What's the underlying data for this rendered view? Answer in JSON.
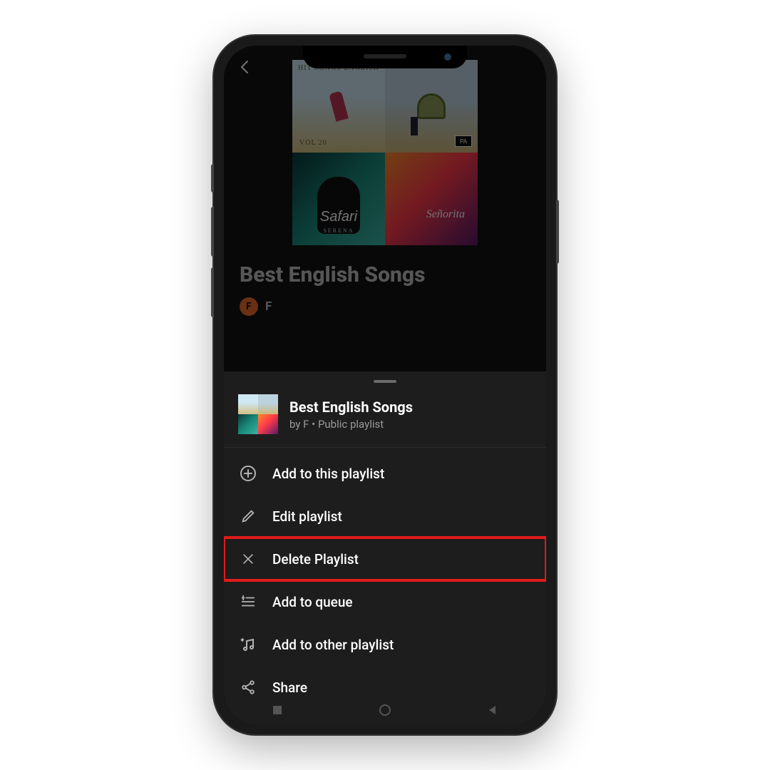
{
  "background": {
    "playlist_title": "Best English Songs",
    "owner_letter": "F",
    "owner_name": "F",
    "album_caption_1": "HIT SONGS ENGLISH",
    "album_caption_1b": "VOL 20",
    "album_caption_3": "Safari",
    "album_caption_3b": "SERENA",
    "parental": "PA"
  },
  "sheet": {
    "title": "Best English Songs",
    "subtitle": "by F • Public playlist",
    "items": [
      {
        "icon": "plus-circle-icon",
        "label": "Add to this playlist",
        "highlighted": false
      },
      {
        "icon": "pencil-icon",
        "label": "Edit playlist",
        "highlighted": false
      },
      {
        "icon": "close-icon",
        "label": "Delete Playlist",
        "highlighted": true
      },
      {
        "icon": "queue-icon",
        "label": "Add to queue",
        "highlighted": false
      },
      {
        "icon": "music-plus-icon",
        "label": "Add to other playlist",
        "highlighted": false
      },
      {
        "icon": "share-icon",
        "label": "Share",
        "highlighted": false
      }
    ]
  },
  "annotation": {
    "highlight_color": "#e21b1b"
  }
}
